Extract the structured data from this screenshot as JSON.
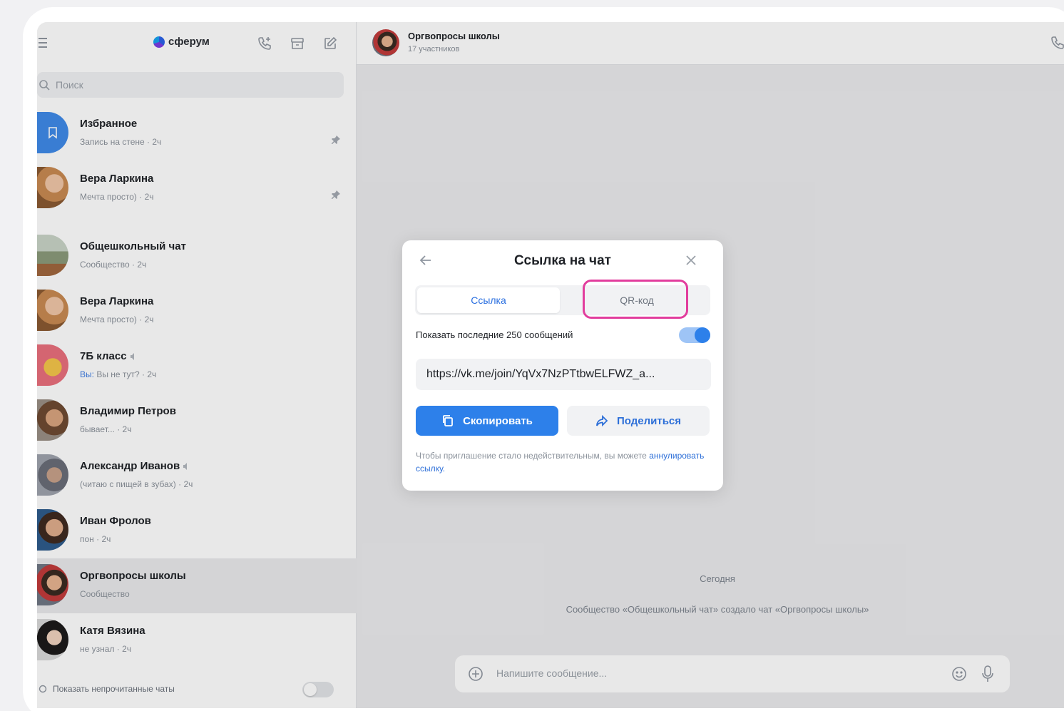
{
  "sidebar": {
    "brand": "сферум",
    "search_placeholder": "Поиск",
    "chats": [
      {
        "name": "Избранное",
        "sub": "Запись на стене · 2ч"
      },
      {
        "name": "Вера Ларкина",
        "sub": "Мечта просто) · 2ч"
      },
      {
        "name": "Общешкольный чат",
        "sub": "Сообщество · 2ч"
      },
      {
        "name": "Вера Ларкина",
        "sub": "Мечта просто) · 2ч"
      },
      {
        "name": "7Б класс",
        "sub_prefix": "Вы:",
        "sub": "Вы не тут? · 2ч"
      },
      {
        "name": "Владимир Петров",
        "sub": "бывает... · 2ч"
      },
      {
        "name": "Александр Иванов",
        "sub": "(читаю с пищей в зубах) · 2ч"
      },
      {
        "name": "Иван Фролов",
        "sub": "пон · 2ч"
      },
      {
        "name": "Оргвопросы школы",
        "sub": "Сообщество"
      },
      {
        "name": "Катя Вязина",
        "sub": "не узнал · 2ч"
      }
    ],
    "footer_label": "Показать непрочитанные чаты"
  },
  "pane": {
    "title": "Оргвопросы школы",
    "subtitle": "17 участников",
    "date_separator": "Сегодня",
    "service_message": "Сообщество «Общешкольный чат» создало чат «Оргвопросы школы»",
    "composer_placeholder": "Напишите сообщение..."
  },
  "modal": {
    "title": "Ссылка на чат",
    "tab_link": "Ссылка",
    "tab_qr": "QR-код",
    "history_label": "Показать последние 250 сообщений",
    "history_enabled": true,
    "link": "https://vk.me/join/YqVx7NzPTtbwELFWZ_a...",
    "copy_label": "Скопировать",
    "share_label": "Поделиться",
    "note_text": "Чтобы приглашение стало недействительным, вы можете ",
    "note_link": "аннулировать ссылку."
  },
  "colors": {
    "accent": "#2d80ea",
    "highlight": "#e23d9d"
  }
}
